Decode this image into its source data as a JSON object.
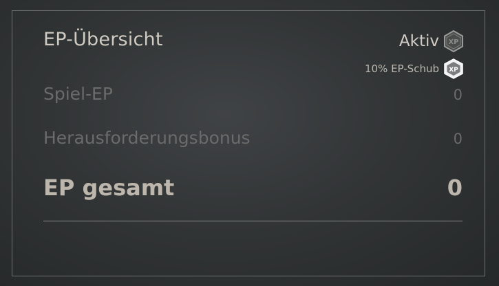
{
  "overview": {
    "title": "EP-Übersicht",
    "status_label": "Aktiv",
    "status_icon": "xp-token-icon",
    "boost_label": "10% EP-Schub",
    "boost_icon": "double-xp-token-icon"
  },
  "rows": [
    {
      "label": "Spiel-EP",
      "value": "0"
    },
    {
      "label": "Herausforderungsbonus",
      "value": "0"
    }
  ],
  "total": {
    "label": "EP gesamt",
    "value": "0"
  },
  "colors": {
    "panel_border": "#6e7172",
    "title": "#cfcac2",
    "muted": "#6a6b6b",
    "total": "#bdb6ad"
  }
}
